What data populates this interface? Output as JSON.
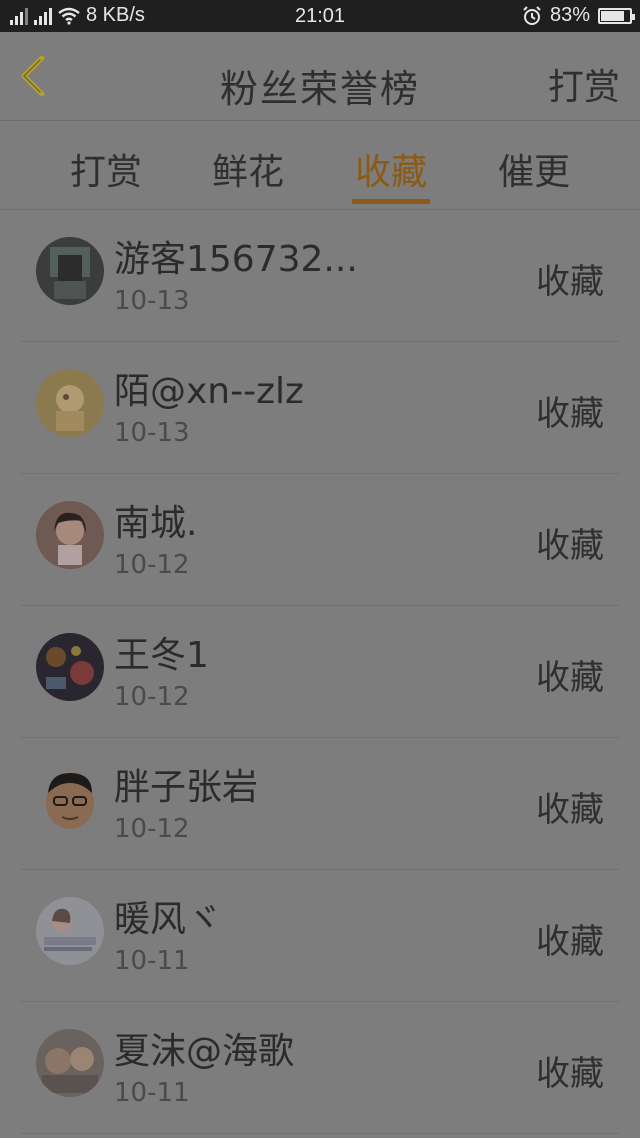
{
  "status_bar": {
    "network_speed": "8 KB/s",
    "time": "21:01",
    "battery": "83%",
    "battery_level": 0.83,
    "icons": [
      "signal-icon",
      "3g-signal-icon",
      "wifi-icon",
      "alarm-icon",
      "battery-icon"
    ]
  },
  "header": {
    "title": "粉丝荣誉榜",
    "action": "打赏",
    "back_icon": "chevron-left-icon"
  },
  "tabs": [
    {
      "label": "打赏",
      "active": false
    },
    {
      "label": "鲜花",
      "active": false
    },
    {
      "label": "收藏",
      "active": true
    },
    {
      "label": "催更",
      "active": false
    }
  ],
  "colors": {
    "accent": "#8b5a14",
    "background": "#7d7d7d",
    "statusbar": "#1f1f1f"
  },
  "list": [
    {
      "name": "游客156732...",
      "date": "10-13",
      "action": "收藏"
    },
    {
      "name": "陌@xn--zlz",
      "date": "10-13",
      "action": "收藏"
    },
    {
      "name": "南城.",
      "date": "10-12",
      "action": "收藏"
    },
    {
      "name": "王冬1",
      "date": "10-12",
      "action": "收藏"
    },
    {
      "name": "胖子张岩",
      "date": "10-12",
      "action": "收藏"
    },
    {
      "name": "暖风ヾ",
      "date": "10-11",
      "action": "收藏"
    },
    {
      "name": "夏沫@海歌",
      "date": "10-11",
      "action": "收藏"
    }
  ]
}
